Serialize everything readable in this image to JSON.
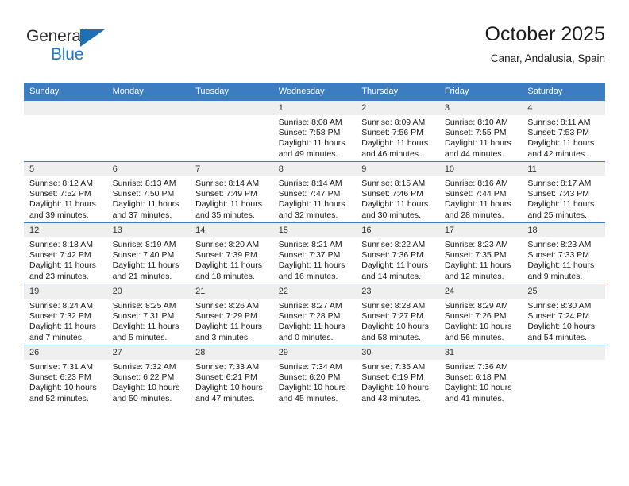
{
  "brand": {
    "name_part1": "General",
    "name_part2": "Blue",
    "accent_color": "#2079c6",
    "triangle_color": "#1f6fb5"
  },
  "header": {
    "title": "October 2025",
    "subtitle": "Canar, Andalusia, Spain"
  },
  "theme": {
    "header_row_bg": "#3b7dc0",
    "daynum_bg": "#efefef",
    "text_color": "#1a1a1a"
  },
  "weekday_headers": [
    "Sunday",
    "Monday",
    "Tuesday",
    "Wednesday",
    "Thursday",
    "Friday",
    "Saturday"
  ],
  "weeks": [
    [
      {
        "day": "",
        "empty": true,
        "sunrise": "",
        "sunset": "",
        "daylight1": "",
        "daylight2": ""
      },
      {
        "day": "",
        "empty": true,
        "sunrise": "",
        "sunset": "",
        "daylight1": "",
        "daylight2": ""
      },
      {
        "day": "",
        "empty": true,
        "sunrise": "",
        "sunset": "",
        "daylight1": "",
        "daylight2": ""
      },
      {
        "day": "1",
        "empty": false,
        "sunrise": "Sunrise: 8:08 AM",
        "sunset": "Sunset: 7:58 PM",
        "daylight1": "Daylight: 11 hours",
        "daylight2": "and 49 minutes."
      },
      {
        "day": "2",
        "empty": false,
        "sunrise": "Sunrise: 8:09 AM",
        "sunset": "Sunset: 7:56 PM",
        "daylight1": "Daylight: 11 hours",
        "daylight2": "and 46 minutes."
      },
      {
        "day": "3",
        "empty": false,
        "sunrise": "Sunrise: 8:10 AM",
        "sunset": "Sunset: 7:55 PM",
        "daylight1": "Daylight: 11 hours",
        "daylight2": "and 44 minutes."
      },
      {
        "day": "4",
        "empty": false,
        "sunrise": "Sunrise: 8:11 AM",
        "sunset": "Sunset: 7:53 PM",
        "daylight1": "Daylight: 11 hours",
        "daylight2": "and 42 minutes."
      }
    ],
    [
      {
        "day": "5",
        "empty": false,
        "sunrise": "Sunrise: 8:12 AM",
        "sunset": "Sunset: 7:52 PM",
        "daylight1": "Daylight: 11 hours",
        "daylight2": "and 39 minutes."
      },
      {
        "day": "6",
        "empty": false,
        "sunrise": "Sunrise: 8:13 AM",
        "sunset": "Sunset: 7:50 PM",
        "daylight1": "Daylight: 11 hours",
        "daylight2": "and 37 minutes."
      },
      {
        "day": "7",
        "empty": false,
        "sunrise": "Sunrise: 8:14 AM",
        "sunset": "Sunset: 7:49 PM",
        "daylight1": "Daylight: 11 hours",
        "daylight2": "and 35 minutes."
      },
      {
        "day": "8",
        "empty": false,
        "sunrise": "Sunrise: 8:14 AM",
        "sunset": "Sunset: 7:47 PM",
        "daylight1": "Daylight: 11 hours",
        "daylight2": "and 32 minutes."
      },
      {
        "day": "9",
        "empty": false,
        "sunrise": "Sunrise: 8:15 AM",
        "sunset": "Sunset: 7:46 PM",
        "daylight1": "Daylight: 11 hours",
        "daylight2": "and 30 minutes."
      },
      {
        "day": "10",
        "empty": false,
        "sunrise": "Sunrise: 8:16 AM",
        "sunset": "Sunset: 7:44 PM",
        "daylight1": "Daylight: 11 hours",
        "daylight2": "and 28 minutes."
      },
      {
        "day": "11",
        "empty": false,
        "sunrise": "Sunrise: 8:17 AM",
        "sunset": "Sunset: 7:43 PM",
        "daylight1": "Daylight: 11 hours",
        "daylight2": "and 25 minutes."
      }
    ],
    [
      {
        "day": "12",
        "empty": false,
        "sunrise": "Sunrise: 8:18 AM",
        "sunset": "Sunset: 7:42 PM",
        "daylight1": "Daylight: 11 hours",
        "daylight2": "and 23 minutes."
      },
      {
        "day": "13",
        "empty": false,
        "sunrise": "Sunrise: 8:19 AM",
        "sunset": "Sunset: 7:40 PM",
        "daylight1": "Daylight: 11 hours",
        "daylight2": "and 21 minutes."
      },
      {
        "day": "14",
        "empty": false,
        "sunrise": "Sunrise: 8:20 AM",
        "sunset": "Sunset: 7:39 PM",
        "daylight1": "Daylight: 11 hours",
        "daylight2": "and 18 minutes."
      },
      {
        "day": "15",
        "empty": false,
        "sunrise": "Sunrise: 8:21 AM",
        "sunset": "Sunset: 7:37 PM",
        "daylight1": "Daylight: 11 hours",
        "daylight2": "and 16 minutes."
      },
      {
        "day": "16",
        "empty": false,
        "sunrise": "Sunrise: 8:22 AM",
        "sunset": "Sunset: 7:36 PM",
        "daylight1": "Daylight: 11 hours",
        "daylight2": "and 14 minutes."
      },
      {
        "day": "17",
        "empty": false,
        "sunrise": "Sunrise: 8:23 AM",
        "sunset": "Sunset: 7:35 PM",
        "daylight1": "Daylight: 11 hours",
        "daylight2": "and 12 minutes."
      },
      {
        "day": "18",
        "empty": false,
        "sunrise": "Sunrise: 8:23 AM",
        "sunset": "Sunset: 7:33 PM",
        "daylight1": "Daylight: 11 hours",
        "daylight2": "and 9 minutes."
      }
    ],
    [
      {
        "day": "19",
        "empty": false,
        "sunrise": "Sunrise: 8:24 AM",
        "sunset": "Sunset: 7:32 PM",
        "daylight1": "Daylight: 11 hours",
        "daylight2": "and 7 minutes."
      },
      {
        "day": "20",
        "empty": false,
        "sunrise": "Sunrise: 8:25 AM",
        "sunset": "Sunset: 7:31 PM",
        "daylight1": "Daylight: 11 hours",
        "daylight2": "and 5 minutes."
      },
      {
        "day": "21",
        "empty": false,
        "sunrise": "Sunrise: 8:26 AM",
        "sunset": "Sunset: 7:29 PM",
        "daylight1": "Daylight: 11 hours",
        "daylight2": "and 3 minutes."
      },
      {
        "day": "22",
        "empty": false,
        "sunrise": "Sunrise: 8:27 AM",
        "sunset": "Sunset: 7:28 PM",
        "daylight1": "Daylight: 11 hours",
        "daylight2": "and 0 minutes."
      },
      {
        "day": "23",
        "empty": false,
        "sunrise": "Sunrise: 8:28 AM",
        "sunset": "Sunset: 7:27 PM",
        "daylight1": "Daylight: 10 hours",
        "daylight2": "and 58 minutes."
      },
      {
        "day": "24",
        "empty": false,
        "sunrise": "Sunrise: 8:29 AM",
        "sunset": "Sunset: 7:26 PM",
        "daylight1": "Daylight: 10 hours",
        "daylight2": "and 56 minutes."
      },
      {
        "day": "25",
        "empty": false,
        "sunrise": "Sunrise: 8:30 AM",
        "sunset": "Sunset: 7:24 PM",
        "daylight1": "Daylight: 10 hours",
        "daylight2": "and 54 minutes."
      }
    ],
    [
      {
        "day": "26",
        "empty": false,
        "sunrise": "Sunrise: 7:31 AM",
        "sunset": "Sunset: 6:23 PM",
        "daylight1": "Daylight: 10 hours",
        "daylight2": "and 52 minutes."
      },
      {
        "day": "27",
        "empty": false,
        "sunrise": "Sunrise: 7:32 AM",
        "sunset": "Sunset: 6:22 PM",
        "daylight1": "Daylight: 10 hours",
        "daylight2": "and 50 minutes."
      },
      {
        "day": "28",
        "empty": false,
        "sunrise": "Sunrise: 7:33 AM",
        "sunset": "Sunset: 6:21 PM",
        "daylight1": "Daylight: 10 hours",
        "daylight2": "and 47 minutes."
      },
      {
        "day": "29",
        "empty": false,
        "sunrise": "Sunrise: 7:34 AM",
        "sunset": "Sunset: 6:20 PM",
        "daylight1": "Daylight: 10 hours",
        "daylight2": "and 45 minutes."
      },
      {
        "day": "30",
        "empty": false,
        "sunrise": "Sunrise: 7:35 AM",
        "sunset": "Sunset: 6:19 PM",
        "daylight1": "Daylight: 10 hours",
        "daylight2": "and 43 minutes."
      },
      {
        "day": "31",
        "empty": false,
        "sunrise": "Sunrise: 7:36 AM",
        "sunset": "Sunset: 6:18 PM",
        "daylight1": "Daylight: 10 hours",
        "daylight2": "and 41 minutes."
      },
      {
        "day": "",
        "empty": true,
        "sunrise": "",
        "sunset": "",
        "daylight1": "",
        "daylight2": ""
      }
    ]
  ]
}
